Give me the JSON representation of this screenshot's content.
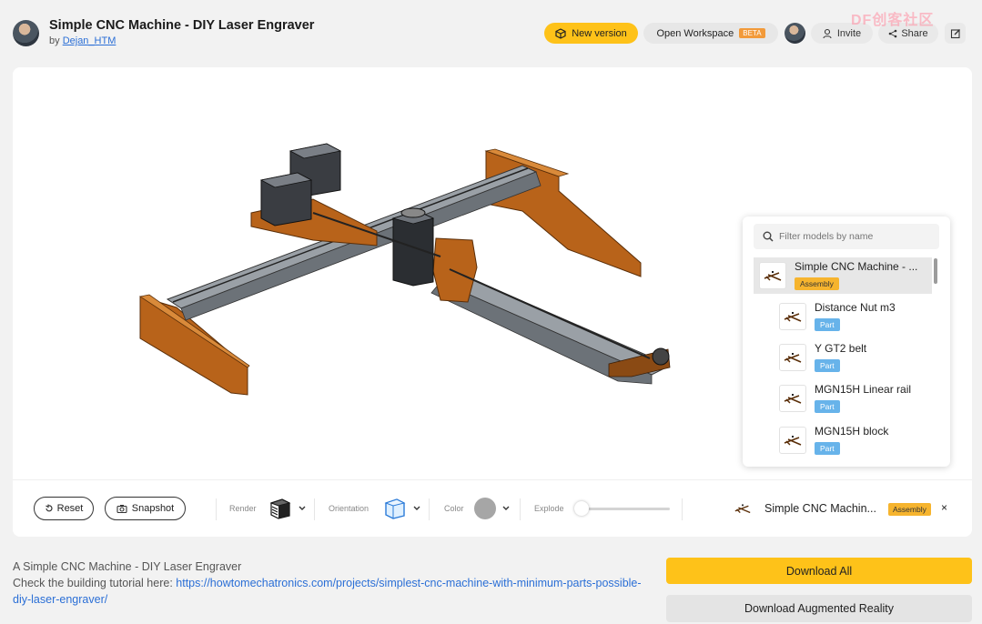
{
  "header": {
    "title": "Simple CNC Machine - DIY Laser Engraver",
    "by_prefix": "by ",
    "author": "Dejan_HTM",
    "new_version_label": "New version",
    "open_workspace_label": "Open Workspace",
    "beta_label": "BETA",
    "invite_label": "Invite",
    "share_label": "Share",
    "watermark": "DF创客社区"
  },
  "models_panel": {
    "filter_placeholder": "Filter models by name",
    "items": [
      {
        "name": "Simple CNC Machine - ...",
        "type": "Assembly",
        "icon": "cnc-thumbnail-icon"
      },
      {
        "name": "Distance Nut m3",
        "type": "Part",
        "icon": "cnc-thumbnail-icon"
      },
      {
        "name": "Y GT2 belt",
        "type": "Part",
        "icon": "cnc-thumbnail-icon"
      },
      {
        "name": "MGN15H Linear rail",
        "type": "Part",
        "icon": "cnc-thumbnail-icon"
      },
      {
        "name": "MGN15H block",
        "type": "Part",
        "icon": "cnc-thumbnail-icon"
      }
    ]
  },
  "toolbar": {
    "reset_label": "Reset",
    "snapshot_label": "Snapshot",
    "render_label": "Render",
    "orientation_label": "Orientation",
    "color_label": "Color",
    "explode_label": "Explode",
    "explode_value": 0,
    "selected_model": "Simple CNC Machin...",
    "selected_type": "Assembly",
    "close_symbol": "×",
    "color_value": "#a6a6a6"
  },
  "description": {
    "line1": "A Simple CNC Machine - DIY Laser Engraver",
    "line2_prefix": "Check the building tutorial here: ",
    "link": "https://howtomechatronics.com/projects/simplest-cnc-machine-with-minimum-parts-possible-diy-laser-engraver/"
  },
  "actions": {
    "download_all": "Download All",
    "download_ar": "Download Augmented Reality"
  },
  "colors": {
    "accent_yellow": "#fec219",
    "part_badge": "#67b3ea",
    "assembly_badge": "#f6b42e",
    "link": "#2b6fd6"
  }
}
